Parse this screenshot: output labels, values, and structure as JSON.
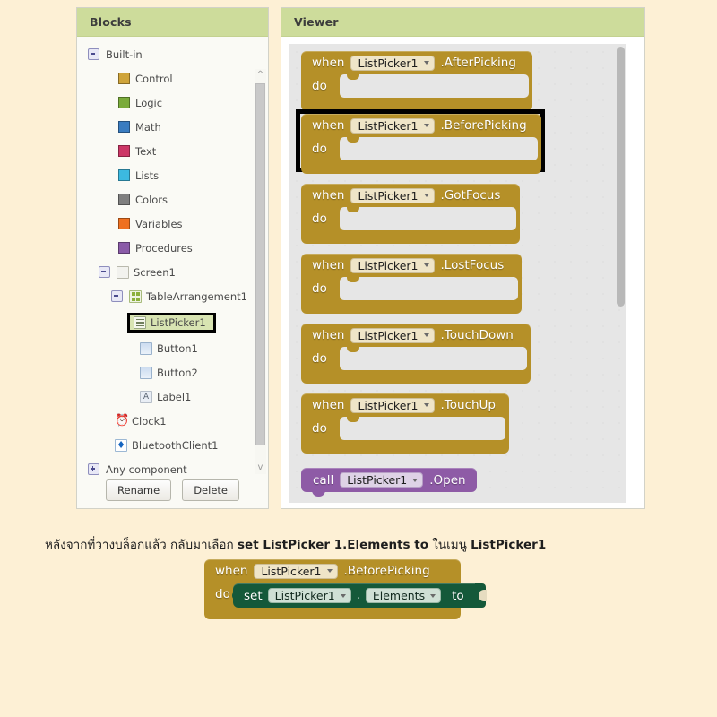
{
  "blocks_panel": {
    "header": "Blocks",
    "builtin": {
      "label": "Built-in",
      "items": [
        {
          "label": "Control",
          "color": "#cfa43a"
        },
        {
          "label": "Logic",
          "color": "#7aab3a"
        },
        {
          "label": "Math",
          "color": "#3a7cc0"
        },
        {
          "label": "Text",
          "color": "#cc3666"
        },
        {
          "label": "Lists",
          "color": "#3cb9e0"
        },
        {
          "label": "Colors",
          "color": "#7f7f7f"
        },
        {
          "label": "Variables",
          "color": "#ef7020"
        },
        {
          "label": "Procedures",
          "color": "#8a5ba8"
        }
      ]
    },
    "tree": {
      "screen": "Screen1",
      "table_arrangement": "TableArrangement1",
      "list_picker": "ListPicker1",
      "button1": "Button1",
      "button2": "Button2",
      "label1": "Label1",
      "clock1": "Clock1",
      "bluetooth": "BluetoothClient1",
      "any_component": "Any component"
    },
    "buttons": {
      "rename": "Rename",
      "delete": "Delete"
    }
  },
  "viewer_panel": {
    "header": "Viewer",
    "blocks": [
      {
        "kw": "when",
        "component": "ListPicker1",
        "event": ".AfterPicking",
        "do": "do",
        "highlighted": false
      },
      {
        "kw": "when",
        "component": "ListPicker1",
        "event": ".BeforePicking",
        "do": "do",
        "highlighted": true
      },
      {
        "kw": "when",
        "component": "ListPicker1",
        "event": ".GotFocus",
        "do": "do",
        "highlighted": false
      },
      {
        "kw": "when",
        "component": "ListPicker1",
        "event": ".LostFocus",
        "do": "do",
        "highlighted": false
      },
      {
        "kw": "when",
        "component": "ListPicker1",
        "event": ".TouchDown",
        "do": "do",
        "highlighted": false
      },
      {
        "kw": "when",
        "component": "ListPicker1",
        "event": ".TouchUp",
        "do": "do",
        "highlighted": false
      }
    ],
    "call_block": {
      "kw": "call",
      "component": "ListPicker1",
      "method": ".Open"
    }
  },
  "caption": {
    "part1": "หลังจากที่วางบล็อกแล้ว กลับมาเลือก ",
    "bold1": "set ListPicker 1.Elements to",
    "part2": " ในเมนู ",
    "bold2": "ListPicker1"
  },
  "bottom_block": {
    "kw": "when",
    "component": "ListPicker1",
    "event": ".BeforePicking",
    "do": "do",
    "set_kw": "set",
    "set_component": "ListPicker1",
    "dot": ".",
    "property": "Elements",
    "to": "to"
  },
  "colors": {
    "page_bg": "#fdf0d5",
    "panel_header": "#cddc9b",
    "block_gold": "#b59028",
    "block_purple": "#8e5ba6",
    "block_green": "#14593a",
    "selection_bg": "#d8e4b2"
  }
}
